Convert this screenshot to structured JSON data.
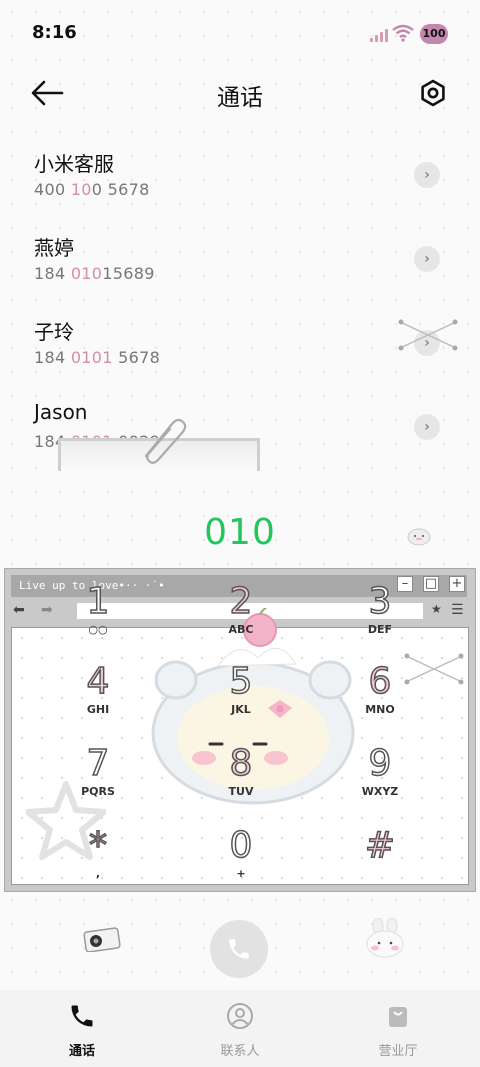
{
  "status": {
    "time": "8:16",
    "battery": "100"
  },
  "header": {
    "title": "通话"
  },
  "contacts": [
    {
      "name": "小米客服",
      "num_a": "400 ",
      "num_hl": "10",
      "num_b": "0 5678"
    },
    {
      "name": "燕婷",
      "num_a": "184 ",
      "num_hl": "010",
      "num_b": "15689"
    },
    {
      "name": "子玲",
      "num_a": "184 ",
      "num_hl": "0101",
      "num_b": " 5678"
    },
    {
      "name": "Jason",
      "num_a": "184 ",
      "num_hl": "0101",
      "num_b": " 0029"
    }
  ],
  "dial": {
    "number": "010"
  },
  "window": {
    "caption": "Live up to love•·· ·˙•"
  },
  "keypad": [
    {
      "digit": "1",
      "letters": "○○"
    },
    {
      "digit": "2",
      "letters": "ABC"
    },
    {
      "digit": "3",
      "letters": "DEF"
    },
    {
      "digit": "4",
      "letters": "GHI"
    },
    {
      "digit": "5",
      "letters": "JKL"
    },
    {
      "digit": "6",
      "letters": "MNO"
    },
    {
      "digit": "7",
      "letters": "PQRS"
    },
    {
      "digit": "8",
      "letters": "TUV"
    },
    {
      "digit": "9",
      "letters": "WXYZ"
    },
    {
      "digit": "*",
      "letters": ","
    },
    {
      "digit": "0",
      "letters": "+"
    },
    {
      "digit": "#",
      "letters": ""
    }
  ],
  "tabs": [
    {
      "label": "通话",
      "icon": "phone-icon",
      "active": true
    },
    {
      "label": "联系人",
      "icon": "contact-icon",
      "active": false
    },
    {
      "label": "营业厅",
      "icon": "shopping-bag-icon",
      "active": false
    }
  ],
  "colors": {
    "dial_number": "#22c55e",
    "highlight": "#d48ea9",
    "battery": "#c486b0"
  }
}
